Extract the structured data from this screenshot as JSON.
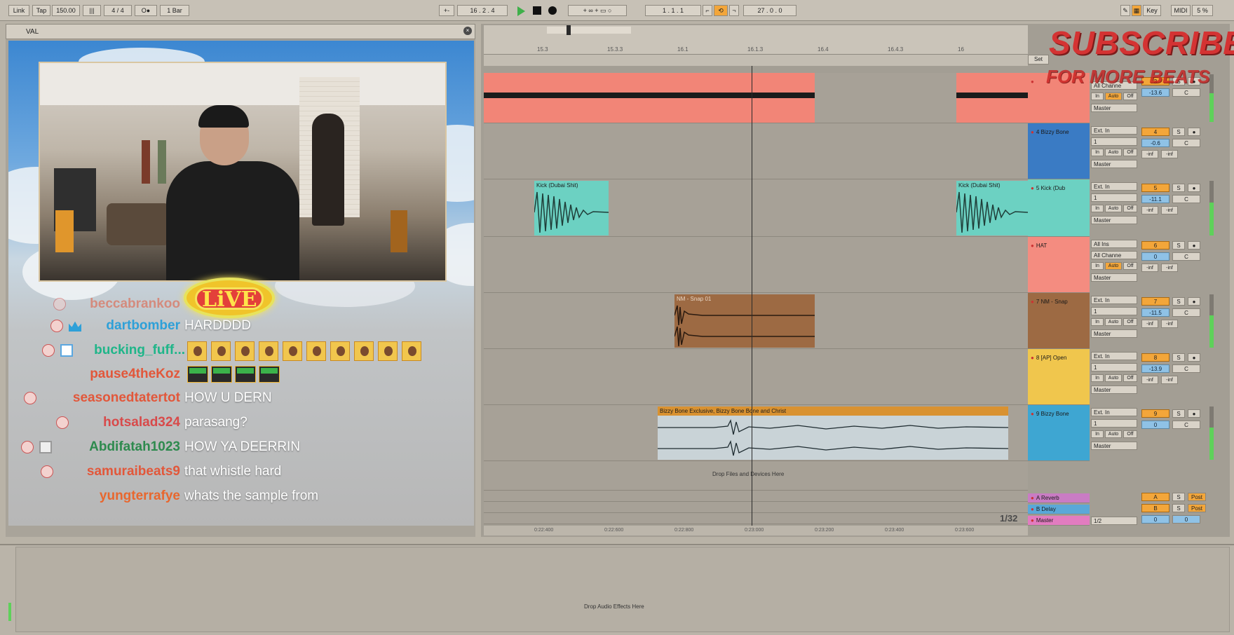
{
  "transport": {
    "link": "Link",
    "tap": "Tap",
    "tempo": "150.00",
    "time_sig": "4 / 4",
    "quantize": "1 Bar",
    "position": "16 .  2 .  4",
    "loop_start": "1 .  1 .  1",
    "loop_length": "27 .  0 .  0",
    "key": "Key",
    "midi": "MIDI",
    "cpu": "5 %"
  },
  "stream": {
    "window_title": "VAL",
    "live_badge": "LiVE",
    "chat": [
      {
        "user": "beccabrankoo",
        "msg": "",
        "color": "#e2573a"
      },
      {
        "user": "dartbomber",
        "msg": "HARDDDD",
        "color": "#2ea0d8"
      },
      {
        "user": "bucking_fuff...",
        "msg": "",
        "color": "#1fb589"
      },
      {
        "user": "pause4theKoz",
        "msg": "",
        "color": "#e2573a"
      },
      {
        "user": "seasonedtatertot",
        "msg": "HOW U DERN",
        "color": "#e2573a"
      },
      {
        "user": "hotsalad324",
        "msg": "parasang?",
        "color": "#d84a4a"
      },
      {
        "user": "Abdifatah1023",
        "msg": "HOW YA DEERRIN",
        "color": "#2e8a4e"
      },
      {
        "user": "samuraibeats9",
        "msg": "that whistle hard",
        "color": "#e2573a"
      },
      {
        "user": "yungterrafye",
        "msg": "whats the sample from",
        "color": "#e8672e"
      }
    ]
  },
  "ruler": {
    "bars": [
      "15.3",
      "15.3.3",
      "16.1",
      "16.1.3",
      "16.4",
      "16.4.3",
      "16"
    ],
    "times": [
      "0:22:400",
      "0:22:600",
      "0:22:800",
      "0:23:000",
      "0:23:200",
      "0:23:400",
      "0:23:600"
    ],
    "page": "1/32"
  },
  "overlay": {
    "subscribe": "SUBSCRIBE",
    "sub2": "FOR MORE BEATS"
  },
  "tracks": [
    {
      "name": "",
      "color": "#f28577",
      "input": "All Channe",
      "num": "3",
      "vol": "-13.6",
      "pan": "C",
      "monitor": "Auto"
    },
    {
      "name": "4 Bizzy Bone",
      "color": "#3a7bc4",
      "input": "Ext. In",
      "num": "4",
      "vol": "-0.6",
      "pan": "C",
      "monitor": "Auto"
    },
    {
      "name": "5 Kick (Dub",
      "color": "#6cd1c2",
      "input": "Ext. In",
      "num": "5",
      "vol": "-11.1",
      "pan": "C",
      "monitor": "Auto"
    },
    {
      "name": "HAT",
      "color": "#f48c80",
      "input": "All Ins",
      "num": "6",
      "vol": "0",
      "pan": "C",
      "monitor": "Auto"
    },
    {
      "name": "7 NM - Snap",
      "color": "#9d6a43",
      "input": "Ext. In",
      "num": "7",
      "vol": "-11.5",
      "pan": "C",
      "monitor": "Auto"
    },
    {
      "name": "8 [AP] Open",
      "color": "#f0c64d",
      "input": "Ext. In",
      "num": "8",
      "vol": "-13.9",
      "pan": "C",
      "monitor": "Auto"
    },
    {
      "name": "9 Bizzy Bone",
      "color": "#3ea6d2",
      "input": "Ext. In",
      "num": "9",
      "vol": "0",
      "pan": "C",
      "monitor": "Auto"
    }
  ],
  "clips": {
    "kick1": "Kick (Dubai Shit)",
    "kick2": "Kick (Dubai Shit)",
    "snap": "NM - Snap 01",
    "vocal": "Bizzy Bone Exclusive, Bizzy Bone Bone and Christ"
  },
  "returns": [
    {
      "name": "A Reverb",
      "letter": "A",
      "color": "#c97cc4"
    },
    {
      "name": "B Delay",
      "letter": "B",
      "color": "#5aa8d8"
    },
    {
      "name": "Master",
      "letter": "1/2",
      "color": "#e27cc0"
    }
  ],
  "io_labels": {
    "ch1": "1",
    "master": "Master",
    "in": "In",
    "auto": "Auto",
    "off": "Off",
    "inf": "-inf",
    "all_channels": "All Channe",
    "solo": "S",
    "post": "Post"
  },
  "labels": {
    "drop_files": "Drop Files and Devices Here",
    "drop_effects": "Drop Audio Effects Here",
    "set": "Set"
  }
}
